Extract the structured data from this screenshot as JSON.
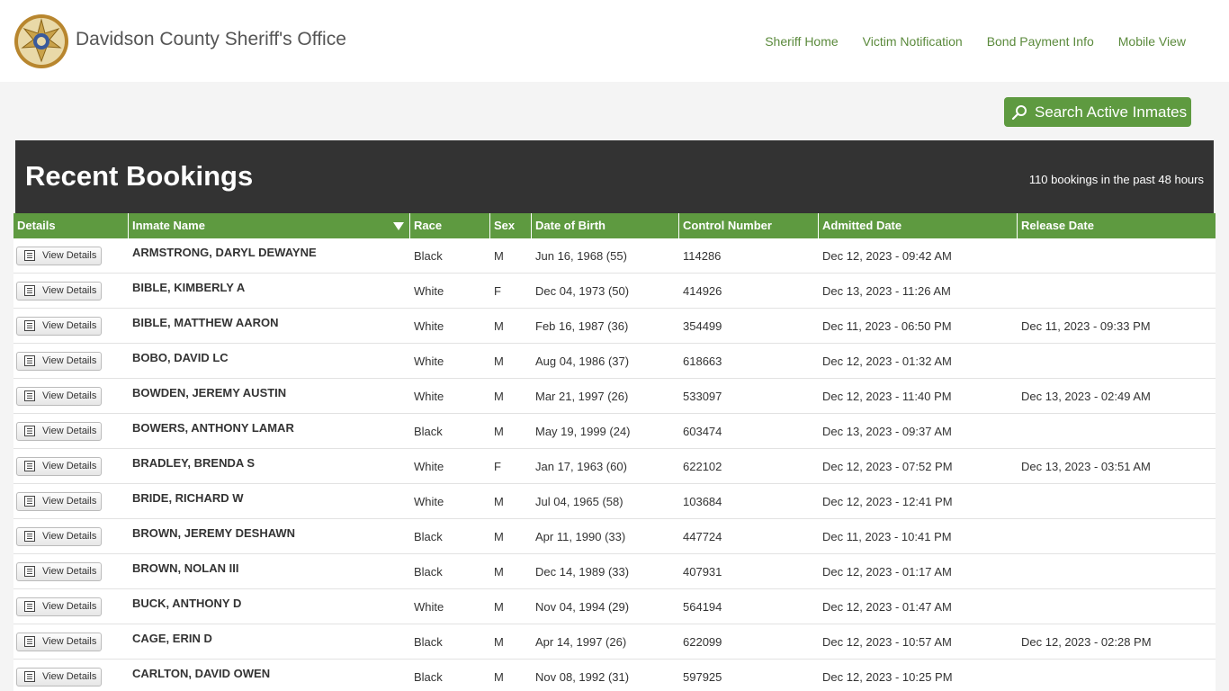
{
  "header": {
    "title": "Davidson County Sheriff's Office",
    "nav": [
      "Sheriff Home",
      "Victim Notification",
      "Bond Payment Info",
      "Mobile View"
    ]
  },
  "search_button": {
    "label": "Search Active Inmates",
    "icon": "search-icon"
  },
  "banner": {
    "title": "Recent Bookings",
    "count_text": "110 bookings in the past 48 hours"
  },
  "table": {
    "columns": [
      "Details",
      "Inmate Name",
      "Race",
      "Sex",
      "Date of Birth",
      "Control Number",
      "Admitted Date",
      "Release Date"
    ],
    "view_label": "View Details",
    "rows": [
      {
        "name": "ARMSTRONG, DARYL  DEWAYNE",
        "race": "Black",
        "sex": "M",
        "dob": "Jun 16, 1968 (55)",
        "control": "114286",
        "admitted": "Dec 12, 2023 - 09:42 AM",
        "release": ""
      },
      {
        "name": "BIBLE, KIMBERLY  A",
        "race": "White",
        "sex": "F",
        "dob": "Dec 04, 1973 (50)",
        "control": "414926",
        "admitted": "Dec 13, 2023 - 11:26 AM",
        "release": ""
      },
      {
        "name": "BIBLE, MATTHEW  AARON",
        "race": "White",
        "sex": "M",
        "dob": "Feb 16, 1987 (36)",
        "control": "354499",
        "admitted": "Dec 11, 2023 - 06:50 PM",
        "release": "Dec 11, 2023 - 09:33 PM"
      },
      {
        "name": "BOBO, DAVID  LC",
        "race": "White",
        "sex": "M",
        "dob": "Aug 04, 1986 (37)",
        "control": "618663",
        "admitted": "Dec 12, 2023 - 01:32 AM",
        "release": ""
      },
      {
        "name": "BOWDEN, JEREMY  AUSTIN",
        "race": "White",
        "sex": "M",
        "dob": "Mar 21, 1997 (26)",
        "control": "533097",
        "admitted": "Dec 12, 2023 - 11:40 PM",
        "release": "Dec 13, 2023 - 02:49 AM"
      },
      {
        "name": "BOWERS, ANTHONY  LAMAR",
        "race": "Black",
        "sex": "M",
        "dob": "May 19, 1999 (24)",
        "control": "603474",
        "admitted": "Dec 13, 2023 - 09:37 AM",
        "release": ""
      },
      {
        "name": "BRADLEY, BRENDA  S",
        "race": "White",
        "sex": "F",
        "dob": "Jan 17, 1963 (60)",
        "control": "622102",
        "admitted": "Dec 12, 2023 - 07:52 PM",
        "release": "Dec 13, 2023 - 03:51 AM"
      },
      {
        "name": "BRIDE, RICHARD  W",
        "race": "White",
        "sex": "M",
        "dob": "Jul 04, 1965 (58)",
        "control": "103684",
        "admitted": "Dec 12, 2023 - 12:41 PM",
        "release": ""
      },
      {
        "name": "BROWN, JEREMY  DESHAWN",
        "race": "Black",
        "sex": "M",
        "dob": "Apr 11, 1990 (33)",
        "control": "447724",
        "admitted": "Dec 11, 2023 - 10:41 PM",
        "release": ""
      },
      {
        "name": "BROWN, NOLAN  III",
        "race": "Black",
        "sex": "M",
        "dob": "Dec 14, 1989 (33)",
        "control": "407931",
        "admitted": "Dec 12, 2023 - 01:17 AM",
        "release": ""
      },
      {
        "name": "BUCK, ANTHONY  D",
        "race": "White",
        "sex": "M",
        "dob": "Nov 04, 1994 (29)",
        "control": "564194",
        "admitted": "Dec 12, 2023 - 01:47 AM",
        "release": ""
      },
      {
        "name": "CAGE, ERIN  D",
        "race": "Black",
        "sex": "M",
        "dob": "Apr 14, 1997 (26)",
        "control": "622099",
        "admitted": "Dec 12, 2023 - 10:57 AM",
        "release": "Dec 12, 2023 - 02:28 PM"
      },
      {
        "name": "CARLTON, DAVID  OWEN",
        "race": "Black",
        "sex": "M",
        "dob": "Nov 08, 1992 (31)",
        "control": "597925",
        "admitted": "Dec 12, 2023 - 10:25 PM",
        "release": ""
      }
    ]
  },
  "colors": {
    "accent": "#5e9a40",
    "banner": "#333333",
    "nav_link": "#5b8a3c"
  }
}
